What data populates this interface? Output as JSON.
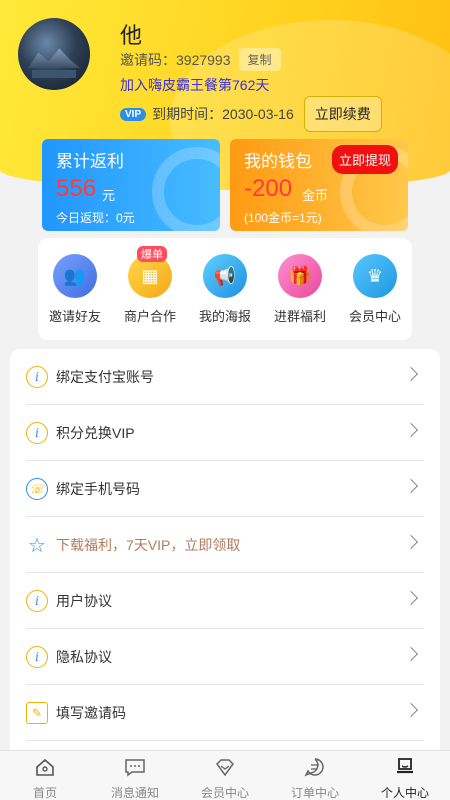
{
  "profile": {
    "name": "他",
    "invite_label": "邀请码：3927993",
    "copy_label": "复制",
    "join_text": "加入嗨皮霸王餐第762天",
    "vip_badge": "VIP",
    "expire_text": "到期时间：2030-03-16",
    "renew_label": "立即续费"
  },
  "cards": {
    "rebate": {
      "title": "累计返利",
      "amount": "556",
      "unit": "元",
      "sub": "今日返现：0元"
    },
    "wallet": {
      "title": "我的钱包",
      "amount": "-200",
      "unit": "金币",
      "sub": "(100金币=1元)",
      "withdraw_label": "立即提现"
    }
  },
  "quick_actions": [
    {
      "label": "邀请好友",
      "icon": "users-icon",
      "color": "#4f7fe8"
    },
    {
      "label": "商户合作",
      "icon": "shop-icon",
      "color": "#f5b31a",
      "badge": "爆单"
    },
    {
      "label": "我的海报",
      "icon": "megaphone-icon",
      "color": "#1ea7e8"
    },
    {
      "label": "进群福利",
      "icon": "gift-icon",
      "color": "#f05aa8"
    },
    {
      "label": "会员中心",
      "icon": "crown-vip-icon",
      "color": "#28a8ec"
    }
  ],
  "menu": [
    {
      "label": "绑定支付宝账号",
      "icon": "info-icon",
      "highlight": false
    },
    {
      "label": "积分兑换VIP",
      "icon": "info-icon",
      "highlight": false
    },
    {
      "label": "绑定手机号码",
      "icon": "phone-icon",
      "highlight": false
    },
    {
      "label": "下载福利，7天VIP，立即领取",
      "icon": "star-icon",
      "highlight": true
    },
    {
      "label": "用户协议",
      "icon": "info-icon",
      "highlight": false
    },
    {
      "label": "隐私协议",
      "icon": "info-icon",
      "highlight": false
    },
    {
      "label": "填写邀请码",
      "icon": "edit-icon",
      "highlight": false
    }
  ],
  "tabs": [
    {
      "label": "首页",
      "icon": "home-icon",
      "active": false
    },
    {
      "label": "消息通知",
      "icon": "message-icon",
      "active": false
    },
    {
      "label": "会员中心",
      "icon": "diamond-icon",
      "active": false
    },
    {
      "label": "订单中心",
      "icon": "order-icon",
      "active": false
    },
    {
      "label": "个人中心",
      "icon": "person-icon",
      "active": true
    }
  ]
}
